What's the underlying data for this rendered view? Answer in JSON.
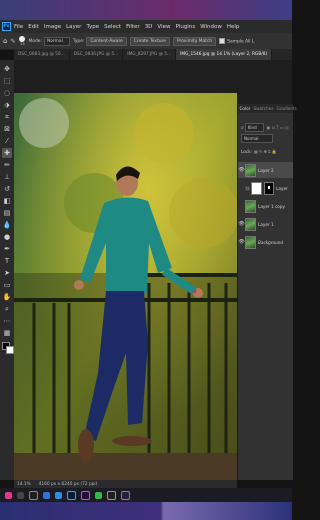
{
  "app": {
    "logo_text": "Ps"
  },
  "menu": [
    "File",
    "Edit",
    "Image",
    "Layer",
    "Type",
    "Select",
    "Filter",
    "3D",
    "View",
    "Plugins",
    "Window",
    "Help"
  ],
  "options": {
    "brush_size": "25",
    "mode_label": "Mode:",
    "mode_value": "Normal",
    "type_label": "Type:",
    "content_aware": "Content-Aware",
    "create_texture": "Create Texture",
    "proximity_match": "Proximity Match",
    "sample_all": "Sample All L"
  },
  "tabs": [
    "DSC_0683.jpg @ 50...",
    "DSC_0836.JPG @ 5...",
    "IMG_8297.JPG @ 5...",
    "IMG_1546.jpg @ 14.1% (Layer 2, RGB/8)"
  ],
  "status": {
    "zoom": "14.1%",
    "doc_size": "4160 px x 6240 px (72 ppi)"
  },
  "panel": {
    "tabs": [
      "Color",
      "Swatches",
      "Gradients"
    ],
    "kind_label": "Kind",
    "blend_mode": "Normal",
    "lock_label": "Lock:"
  },
  "layers": [
    {
      "name": "Layer 2",
      "visible": true
    },
    {
      "name": "Layer",
      "visible": false
    },
    {
      "name": "Layer 1 copy",
      "visible": false
    },
    {
      "name": "Layer 1",
      "visible": true
    },
    {
      "name": "Background",
      "visible": true
    }
  ],
  "colors": {
    "accent": "#31a8ff",
    "panel": "#323232",
    "menubar": "#2b2b2b"
  }
}
